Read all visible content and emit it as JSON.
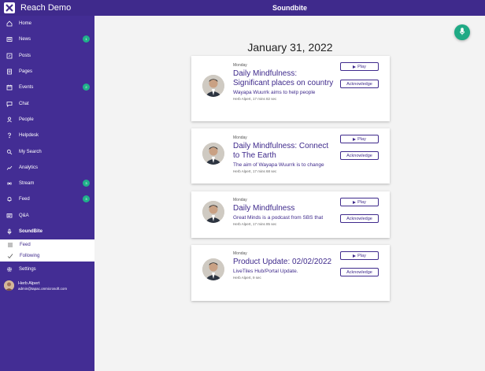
{
  "app": {
    "name": "Reach Demo",
    "page_title": "Soundbite"
  },
  "sidebar": {
    "items": [
      {
        "label": "Home",
        "icon": "home-icon"
      },
      {
        "label": "News",
        "icon": "news-icon",
        "badge": "1"
      },
      {
        "label": "Posts",
        "icon": "posts-icon"
      },
      {
        "label": "Pages",
        "icon": "pages-icon"
      },
      {
        "label": "Events",
        "icon": "events-icon",
        "badge": "2"
      },
      {
        "label": "Chat",
        "icon": "chat-icon"
      },
      {
        "label": "People",
        "icon": "people-icon"
      },
      {
        "label": "Helpdesk",
        "icon": "help-icon"
      },
      {
        "label": "My Search",
        "icon": "search-icon"
      },
      {
        "label": "Analytics",
        "icon": "analytics-icon"
      },
      {
        "label": "Stream",
        "icon": "stream-icon",
        "badge": "3"
      },
      {
        "label": "Feed",
        "icon": "bell-icon",
        "badge": "3"
      },
      {
        "label": "Q&A",
        "icon": "qa-icon"
      },
      {
        "label": "SoundBite",
        "icon": "mic-icon"
      }
    ],
    "subitems": [
      {
        "label": "Feed",
        "icon": "list-icon"
      },
      {
        "label": "Following",
        "icon": "check-icon"
      }
    ],
    "settings_label": "Settings",
    "user": {
      "name": "Herb Alpert",
      "email": "admin@tapac.onmicrosoft.com"
    }
  },
  "main": {
    "date_heading": "January 31, 2022",
    "play_label": "Play",
    "acknowledge_label": "Acknowledge",
    "cards": [
      {
        "day": "Monday",
        "title": "Daily Mindfulness: Significant places on country",
        "desc": "Wayapa Wuurrk aims to help people",
        "meta": "Herb Alpert, 17 mins 82 sec"
      },
      {
        "day": "Monday",
        "title": "Daily Mindfulness: Connect to The Earth",
        "desc": "The aim of Wayapa Wuurrk is to change",
        "meta": "Herb Alpert, 17 mins 68 sec"
      },
      {
        "day": "Monday",
        "title": "Daily Mindfulness",
        "desc": "Great Minds is a podcast from SBS that",
        "meta": "Herb Alpert, 17 mins 85 sec"
      },
      {
        "day": "Monday",
        "title": "Product Update: 02/02/2022",
        "desc": "LiveTiles Hub/Portal Update.",
        "meta": "Herb Alpert, 9 sec"
      }
    ]
  },
  "colors": {
    "primary": "#3f2a8c",
    "sidebar": "#432d94",
    "accent": "#1faa85"
  }
}
